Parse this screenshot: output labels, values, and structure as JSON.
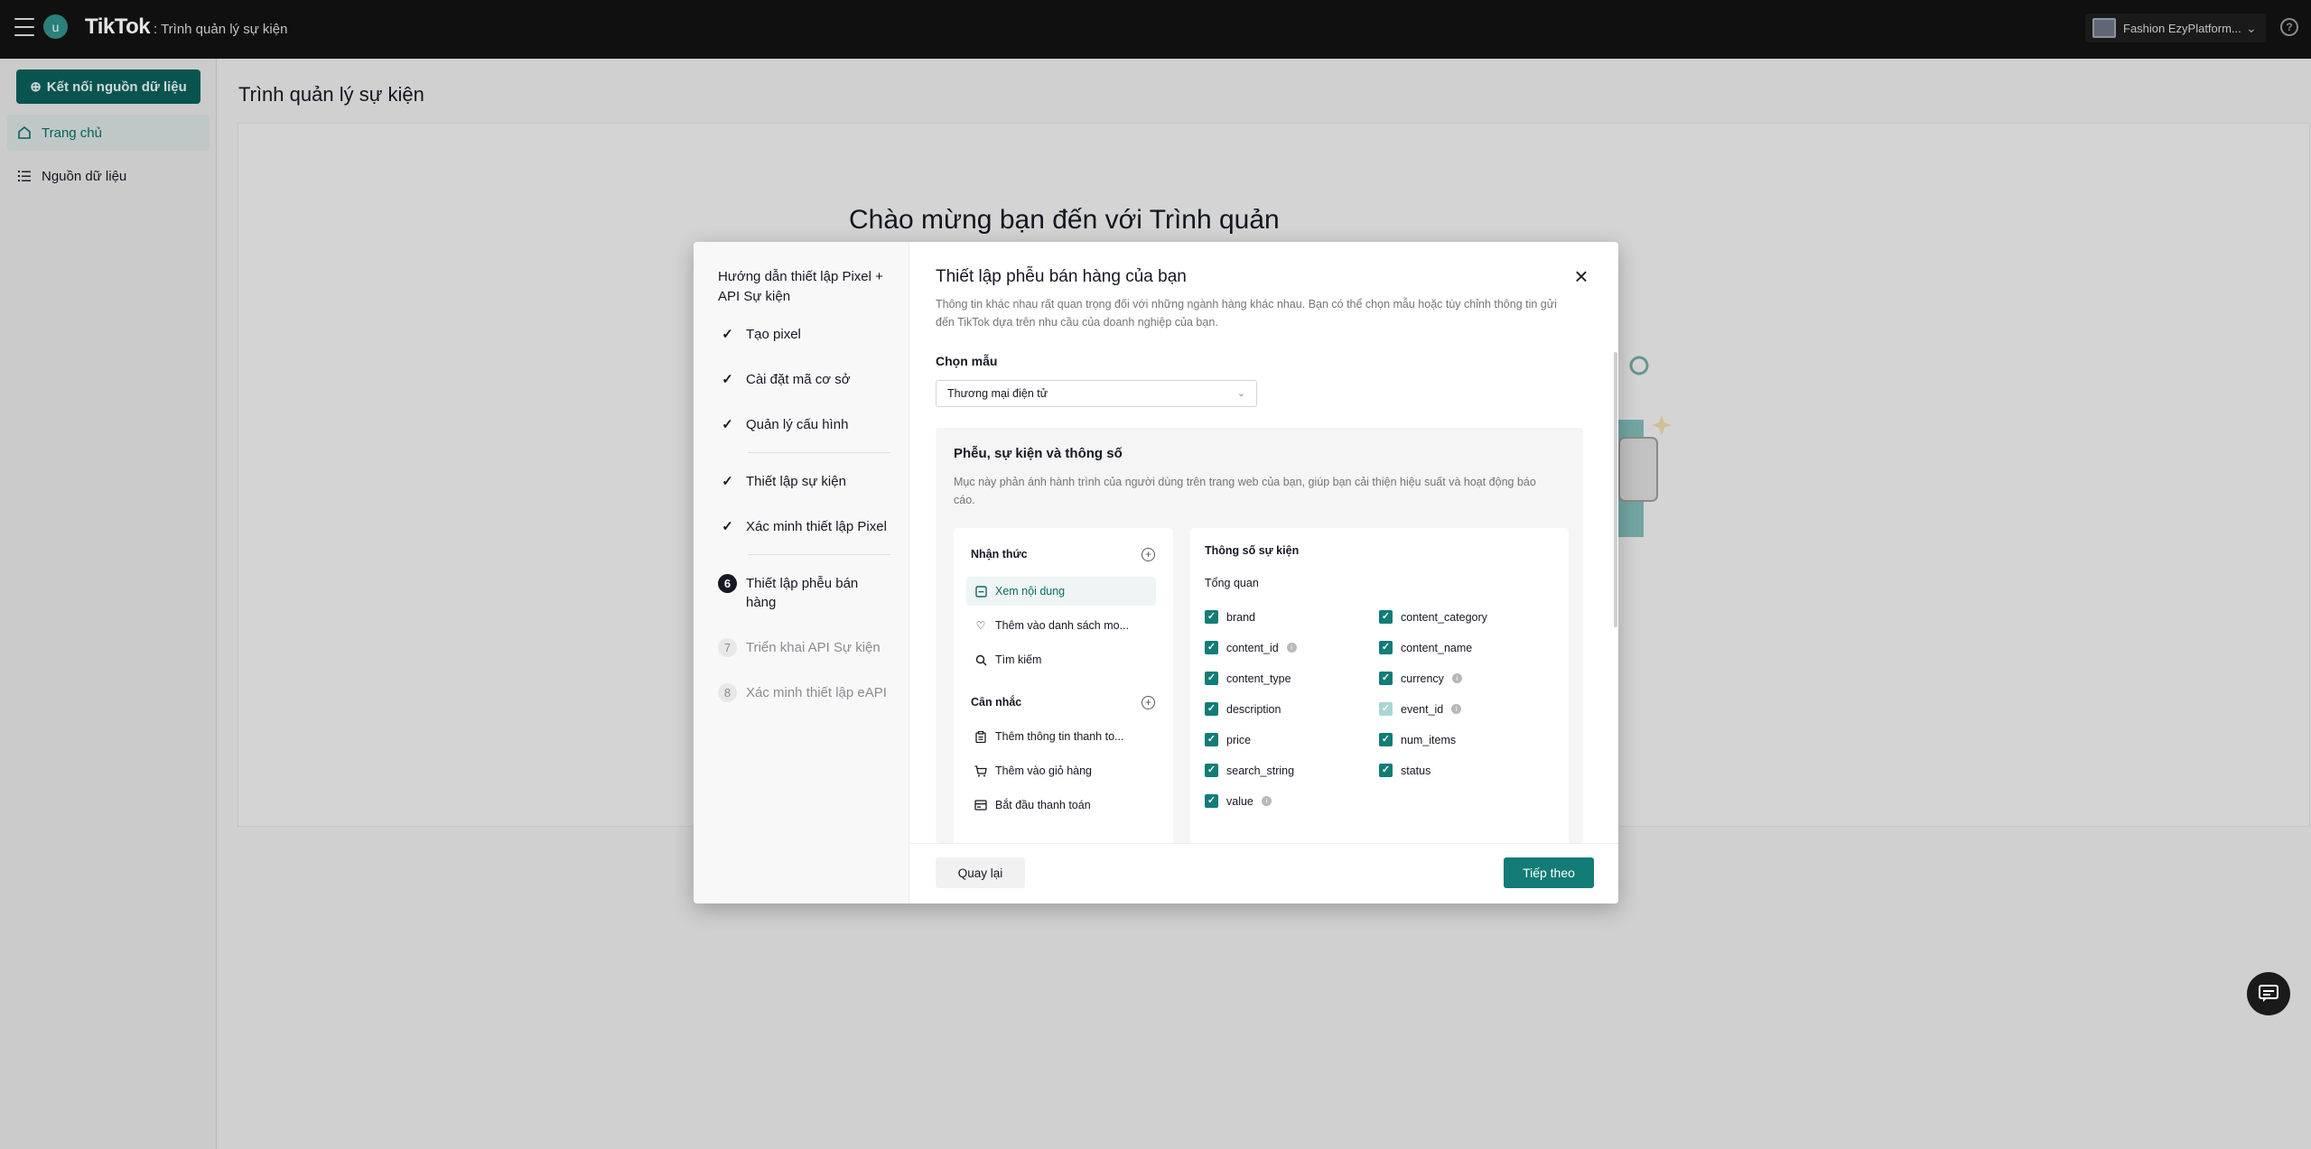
{
  "topbar": {
    "avatar_letter": "u",
    "brand": "TikTok",
    "brand_sub": ": Trình quản lý sự kiện",
    "account_name": "Fashion EzyPlatform..."
  },
  "sidebar": {
    "connect_button": "Kết nối nguồn dữ liệu",
    "items": [
      {
        "label": "Trang chủ",
        "icon": "home-icon",
        "active": true
      },
      {
        "label": "Nguồn dữ liệu",
        "icon": "list-icon",
        "active": false
      }
    ]
  },
  "page": {
    "title": "Trình quản lý sự kiện",
    "welcome": "Chào mừng bạn đến với Trình quản"
  },
  "modal": {
    "guide_title": "Hướng dẫn thiết lập Pixel + API Sự kiện",
    "steps": [
      {
        "label": "Tạo pixel",
        "mark": "✓",
        "state": "done"
      },
      {
        "label": "Cài đặt mã cơ sở",
        "mark": "✓",
        "state": "done"
      },
      {
        "label": "Quản lý cấu hình",
        "mark": "✓",
        "state": "done"
      },
      {
        "label": "Thiết lập sự kiện",
        "mark": "✓",
        "state": "done"
      },
      {
        "label": "Xác minh thiết lập Pixel",
        "mark": "✓",
        "state": "done"
      },
      {
        "label": "Thiết lập phễu bán hàng",
        "mark": "6",
        "state": "current"
      },
      {
        "label": "Triển khai API Sự kiện",
        "mark": "7",
        "state": "todo"
      },
      {
        "label": "Xác minh thiết lập eAPI",
        "mark": "8",
        "state": "todo"
      }
    ],
    "title": "Thiết lập phễu bán hàng của bạn",
    "description": "Thông tin khác nhau rất quan trọng đối với những ngành hàng khác nhau. Bạn có thể chọn mẫu hoặc tùy chỉnh thông tin gửi đến TikTok dựa trên nhu cầu của doanh nghiệp của bạn.",
    "template_label": "Chọn mẫu",
    "template_value": "Thương mại điện tử",
    "funnel": {
      "title": "Phễu, sự kiện và thông số",
      "description": "Mục này phản ánh hành trình của người dùng trên trang web của bạn, giúp bạn cải thiện hiệu suất và hoạt động báo cáo.",
      "awareness": {
        "label": "Nhận thức",
        "events": [
          {
            "label": "Xem nội dung",
            "icon": "view-content-icon",
            "active": true
          },
          {
            "label": "Thêm vào danh sách mo...",
            "icon": "heart-icon",
            "active": false
          },
          {
            "label": "Tìm kiếm",
            "icon": "search-icon",
            "active": false
          }
        ]
      },
      "consideration": {
        "label": "Cân nhắc",
        "events": [
          {
            "label": "Thêm thông tin thanh to...",
            "icon": "clipboard-icon",
            "active": false
          },
          {
            "label": "Thêm vào giỏ hàng",
            "icon": "cart-icon",
            "active": false
          },
          {
            "label": "Bắt đầu thanh toán",
            "icon": "checkout-icon",
            "active": false
          }
        ]
      },
      "params": {
        "title": "Thông số sự kiện",
        "subtitle": "Tổng quan",
        "items": [
          {
            "name": "brand",
            "checked": true,
            "disabled": false,
            "info": false
          },
          {
            "name": "content_category",
            "checked": true,
            "disabled": false,
            "info": false
          },
          {
            "name": "content_id",
            "checked": true,
            "disabled": false,
            "info": true
          },
          {
            "name": "content_name",
            "checked": true,
            "disabled": false,
            "info": false
          },
          {
            "name": "content_type",
            "checked": true,
            "disabled": false,
            "info": false
          },
          {
            "name": "currency",
            "checked": true,
            "disabled": false,
            "info": true
          },
          {
            "name": "description",
            "checked": true,
            "disabled": false,
            "info": false
          },
          {
            "name": "event_id",
            "checked": true,
            "disabled": true,
            "info": true
          },
          {
            "name": "price",
            "checked": true,
            "disabled": false,
            "info": false
          },
          {
            "name": "num_items",
            "checked": true,
            "disabled": false,
            "info": false
          },
          {
            "name": "search_string",
            "checked": true,
            "disabled": false,
            "info": false
          },
          {
            "name": "status",
            "checked": true,
            "disabled": false,
            "info": false
          },
          {
            "name": "value",
            "checked": true,
            "disabled": false,
            "info": true
          }
        ]
      }
    },
    "back_button": "Quay lại",
    "next_button": "Tiếp theo"
  },
  "colors": {
    "accent": "#127c76",
    "topbar": "#121212",
    "sidebar_button": "#0c5e5a"
  }
}
